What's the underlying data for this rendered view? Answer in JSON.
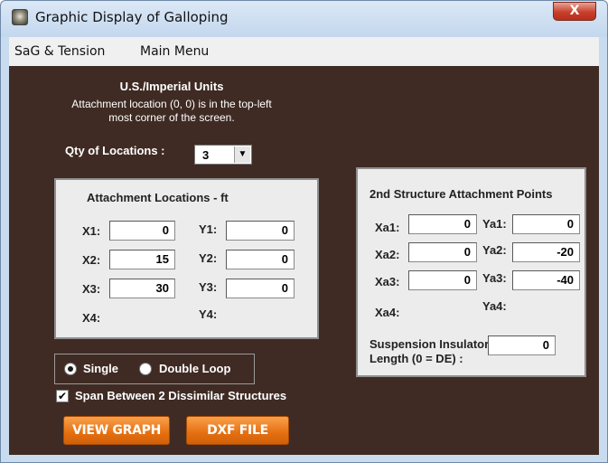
{
  "window": {
    "title": "Graphic Display of Galloping",
    "close_glyph": "X"
  },
  "menu": {
    "items": [
      "SaG & Tension",
      "Main Menu"
    ]
  },
  "header": {
    "units": "U.S./Imperial Units",
    "note_line1": "Attachment location (0, 0) is in the top-left",
    "note_line2": "most corner of the screen."
  },
  "qty": {
    "label": "Qty of Locations :",
    "value": "3",
    "arrow": "▼"
  },
  "attachment": {
    "title": "Attachment Locations -   ft",
    "rows": [
      {
        "x_label": "X1:",
        "x_value": "0",
        "y_label": "Y1:",
        "y_value": "0"
      },
      {
        "x_label": "X2:",
        "x_value": "15",
        "y_label": "Y2:",
        "y_value": "0"
      },
      {
        "x_label": "X3:",
        "x_value": "30",
        "y_label": "Y3:",
        "y_value": "0"
      }
    ],
    "x4_label": "X4:",
    "y4_label": "Y4:"
  },
  "second_structure": {
    "title": "2nd Structure Attachment Points",
    "rows": [
      {
        "x_label": "Xa1:",
        "x_value": "0",
        "y_label": "Ya1:",
        "y_value": "0"
      },
      {
        "x_label": "Xa2:",
        "x_value": "0",
        "y_label": "Ya2:",
        "y_value": "-20"
      },
      {
        "x_label": "Xa3:",
        "x_value": "0",
        "y_label": "Ya3:",
        "y_value": "-40"
      }
    ],
    "xa4_label": "Xa4:",
    "ya4_label": "Ya4:",
    "insulator_line1": "Suspension Insulator",
    "insulator_line2": "Length (0 = DE) :",
    "insulator_value": "0"
  },
  "loop": {
    "single_label": "Single",
    "double_label": "Double Loop",
    "selected": "Single"
  },
  "span": {
    "label": "Span Between 2 Dissimilar Structures",
    "checked": true,
    "check_glyph": "✔"
  },
  "buttons": {
    "view_graph": "VIEW GRAPH",
    "dxf_file": "DXF FILE"
  },
  "colors": {
    "background": "#3f2b24",
    "panel": "#ececec",
    "button": "#e56f10",
    "title_bar": "#c9dcef"
  }
}
